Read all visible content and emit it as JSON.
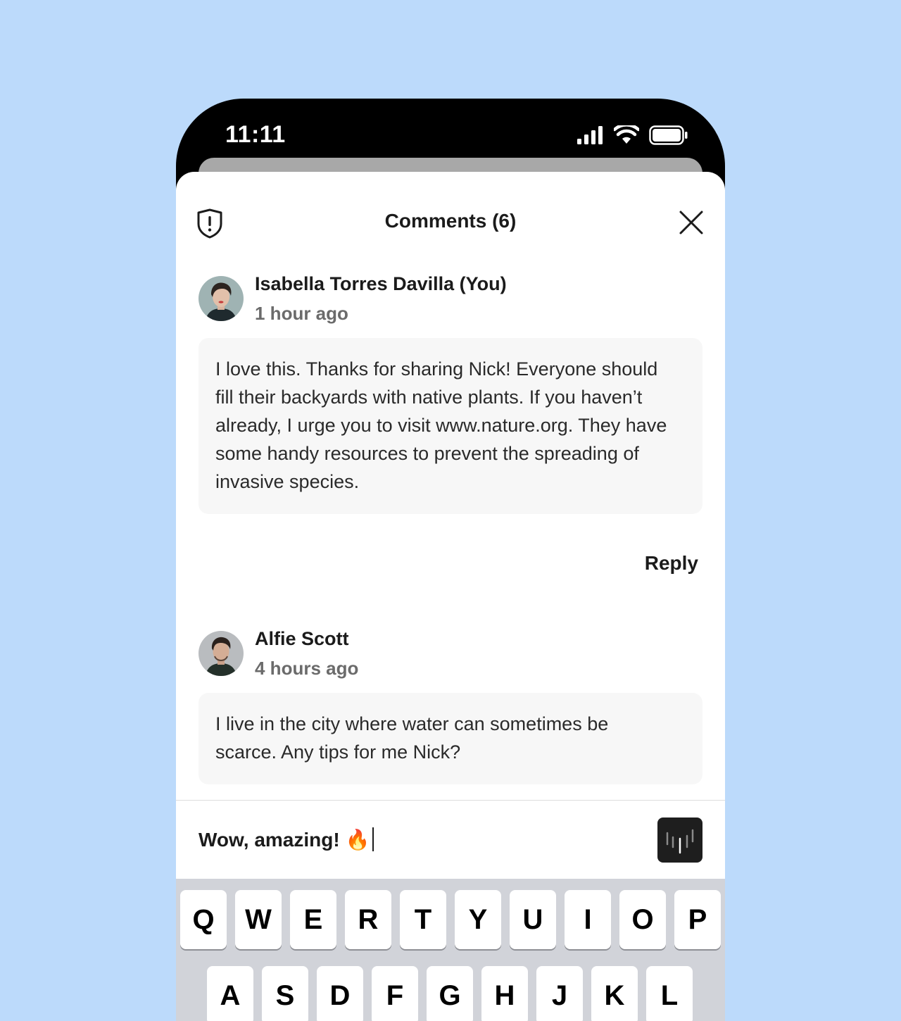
{
  "status_bar": {
    "time": "11:11"
  },
  "header": {
    "title": "Comments (6)"
  },
  "comments": [
    {
      "author": "Isabella Torres Davilla (You)",
      "time": "1 hour ago",
      "text": "I love this. Thanks for sharing Nick! Everyone should fill their backyards with native plants. If you haven’t already, I urge you to visit www.nature.org. They have some handy resources to prevent the spreading of invasive species.",
      "reply_label": "Reply"
    },
    {
      "author": "Alfie Scott",
      "time": "4 hours ago",
      "text": "I live in the city where water can sometimes be scarce. Any tips for me Nick?"
    }
  ],
  "composer": {
    "value": "Wow, amazing! 🔥"
  },
  "keyboard": {
    "row1": [
      "Q",
      "W",
      "E",
      "R",
      "T",
      "Y",
      "U",
      "I",
      "O",
      "P"
    ],
    "row2": [
      "A",
      "S",
      "D",
      "F",
      "G",
      "H",
      "J",
      "K",
      "L"
    ]
  },
  "colors": {
    "background": "#bcdafb",
    "send_button": "#1e1e1e",
    "keyboard": "#d1d3d9"
  }
}
